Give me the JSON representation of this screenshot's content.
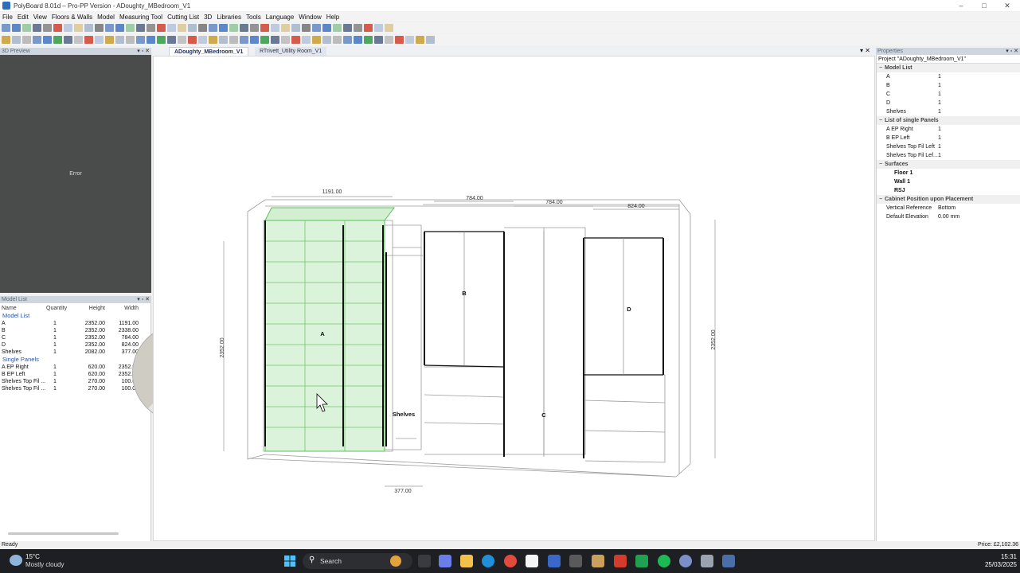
{
  "window": {
    "title": "PolyBoard 8.01d – Pro-PP Version - ADoughty_MBedroom_V1",
    "controls": {
      "minimize": "–",
      "maximize": "□",
      "close": "✕"
    }
  },
  "menu": [
    "File",
    "Edit",
    "View",
    "Floors & Walls",
    "Model",
    "Measuring Tool",
    "Cutting List",
    "3D",
    "Libraries",
    "Tools",
    "Language",
    "Window",
    "Help"
  ],
  "preview_panel": {
    "title": "3D Preview",
    "error_text": "Error"
  },
  "model_list_panel": {
    "title": "Model List",
    "columns": [
      "Name",
      "Quantity",
      "Height",
      "Width"
    ],
    "groups": [
      {
        "label": "Model List",
        "rows": [
          [
            "A",
            "1",
            "2352.00",
            "1191.00"
          ],
          [
            "B",
            "1",
            "2352.00",
            "2338.00"
          ],
          [
            "C",
            "1",
            "2352.00",
            "784.00"
          ],
          [
            "D",
            "1",
            "2352.00",
            "824.00"
          ],
          [
            "Shelves",
            "1",
            "2082.00",
            "377.00"
          ]
        ]
      },
      {
        "label": "Single Panels",
        "rows": [
          [
            "A EP Right",
            "1",
            "620.00",
            "2352.00"
          ],
          [
            "B EP Left",
            "1",
            "620.00",
            "2352.00"
          ],
          [
            "Shelves Top Fil ...",
            "1",
            "270.00",
            "100.00"
          ],
          [
            "Shelves Top Fil ...",
            "1",
            "270.00",
            "100.00"
          ]
        ]
      }
    ]
  },
  "tabs": [
    {
      "label": "ADoughty_MBedroom_V1",
      "active": true
    },
    {
      "label": "RTrivett_Utility Room_V1",
      "active": false
    }
  ],
  "drawing": {
    "dimensions": [
      "1191.00",
      "784.00",
      "784.00",
      "824.00",
      "2352.00",
      "2352.00",
      "377.00"
    ],
    "labels": [
      "A",
      "B",
      "C",
      "D",
      "Shelves"
    ],
    "selected_color": "#7fd37a"
  },
  "properties_panel": {
    "title": "Properties",
    "project": "Project \"ADoughty_MBedroom_V1\"",
    "categories": [
      {
        "label": "Model List",
        "rows": [
          [
            "A",
            "1"
          ],
          [
            "B",
            "1"
          ],
          [
            "C",
            "1"
          ],
          [
            "D",
            "1"
          ],
          [
            "Shelves",
            "1"
          ]
        ]
      },
      {
        "label": "List of single Panels",
        "rows": [
          [
            "A EP Right",
            "1"
          ],
          [
            "B EP Left",
            "1"
          ],
          [
            "Shelves Top Fil Left",
            "1"
          ],
          [
            "Shelves Top Fil Lef...",
            "1"
          ]
        ]
      },
      {
        "label": "Surfaces",
        "rows": [
          [
            "Floor 1",
            ""
          ],
          [
            "Wall 1",
            ""
          ],
          [
            "RSJ",
            ""
          ]
        ]
      },
      {
        "label": "Cabinet Position upon Placement",
        "rows": [
          [
            "Vertical Reference",
            "Bottom"
          ],
          [
            "Default Elevation",
            "0.00 mm"
          ]
        ]
      }
    ]
  },
  "status": {
    "left": "Ready",
    "right": "Price: £2,102.36"
  },
  "taskbar": {
    "weather_temp": "15°C",
    "weather_desc": "Mostly cloudy",
    "search_label": "Search",
    "time": "15:31",
    "date": "25/03/2025"
  }
}
